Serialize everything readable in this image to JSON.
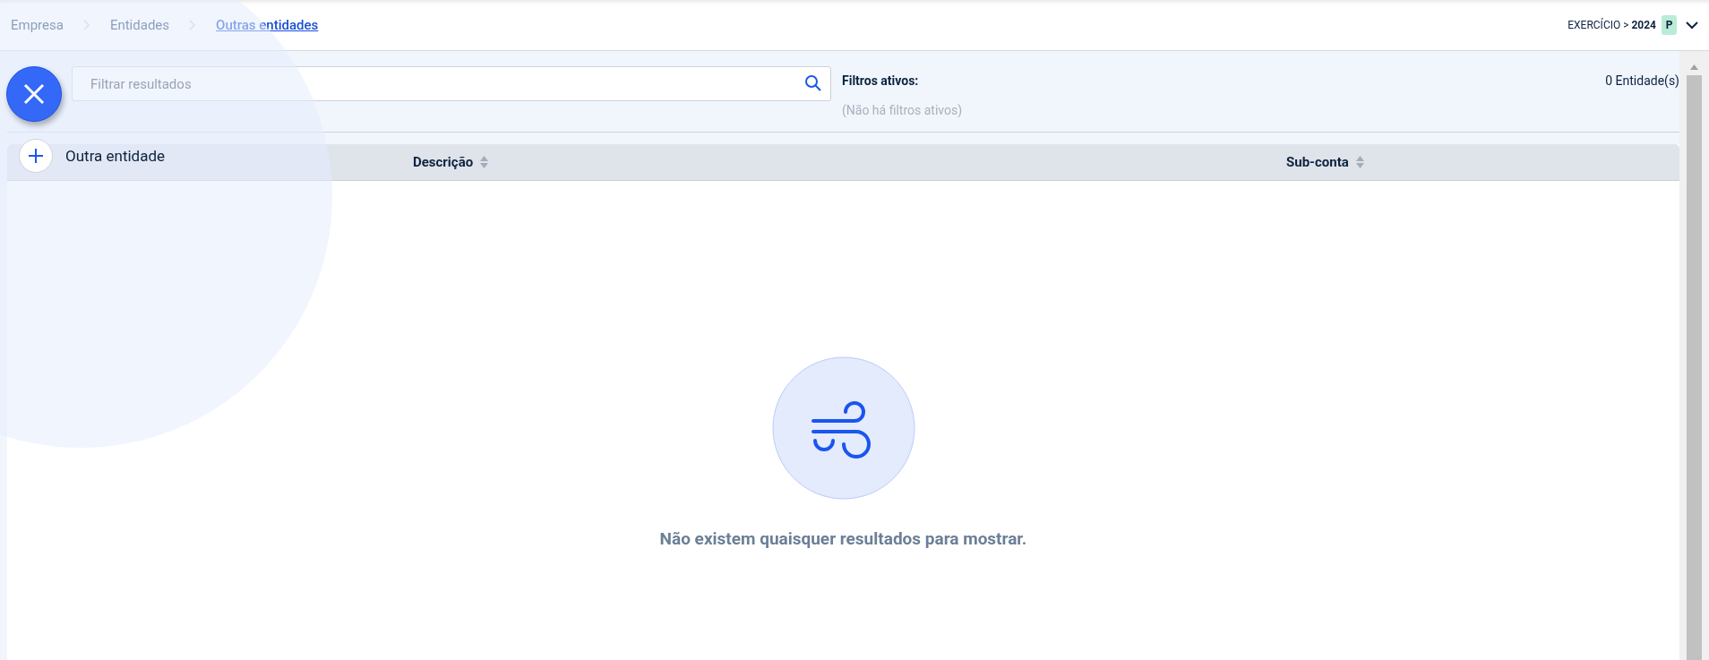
{
  "breadcrumbs": [
    {
      "label": "Empresa",
      "current": false
    },
    {
      "label": "Entidades",
      "current": false
    },
    {
      "label": "Outras entidades",
      "current": true
    }
  ],
  "exercise": {
    "label": "EXERCÍCIO >",
    "year": "2024",
    "avatar": "P"
  },
  "search": {
    "placeholder": "Filtrar resultados"
  },
  "filters": {
    "title": "Filtros ativos:",
    "empty": "(Não há filtros ativos)"
  },
  "count": "0 Entidade(s)",
  "table": {
    "columns": [
      {
        "label": "Descrição"
      },
      {
        "label": "Sub-conta"
      }
    ]
  },
  "empty_state": {
    "message": "Não existem quaisquer resultados para mostrar."
  },
  "fab_menu": {
    "expanded": true,
    "items": [
      {
        "label": "Outra entidade"
      }
    ]
  }
}
